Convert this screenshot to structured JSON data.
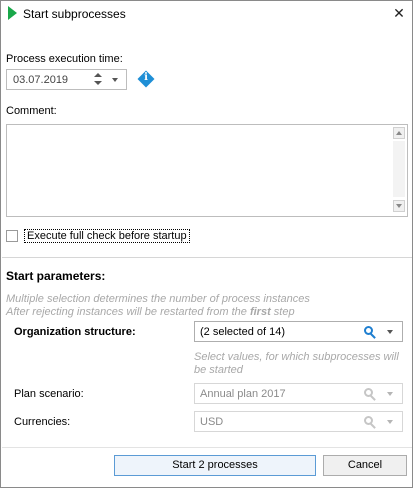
{
  "window": {
    "title": "Start subprocesses",
    "close_glyph": "✕"
  },
  "execution": {
    "label": "Process execution time:",
    "date_value": "03.07.2019",
    "info_glyph": "i"
  },
  "comment": {
    "label": "Comment:",
    "value": ""
  },
  "full_check": {
    "label": "Execute full check before startup",
    "checked": false
  },
  "start_params": {
    "title": "Start parameters:",
    "hint_line1": "Multiple selection determines the number of process instances",
    "hint_line2_prefix": "After rejecting instances will be restarted from the ",
    "hint_line2_bold": "first",
    "hint_line2_suffix": " step",
    "org": {
      "label": "Organization structure:",
      "value": "(2 selected of 14)",
      "hint_line1": "Select values, for which subprocesses will",
      "hint_line2": "be started"
    },
    "plan": {
      "label": "Plan scenario:",
      "value": "Annual plan 2017"
    },
    "currencies": {
      "label": "Currencies:",
      "value": "USD"
    }
  },
  "buttons": {
    "start": "Start 2 processes",
    "cancel": "Cancel"
  },
  "colors": {
    "accent": "#1f7fd0",
    "title_icon": "#1aa84a",
    "hint_text": "#a8a8a8"
  }
}
